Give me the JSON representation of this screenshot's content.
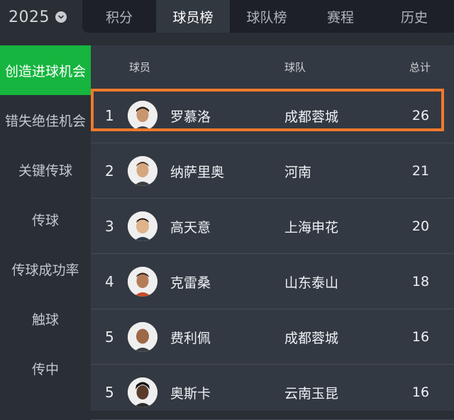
{
  "header": {
    "year": "2025",
    "year_icon": "chevron-down-icon",
    "tabs": [
      {
        "label": "积分"
      },
      {
        "label": "球员榜"
      },
      {
        "label": "球队榜"
      },
      {
        "label": "赛程"
      },
      {
        "label": "历史"
      }
    ],
    "active_tab": "球员榜"
  },
  "sidebar": {
    "items": [
      {
        "label": "创造进球机会"
      },
      {
        "label": "错失绝佳机会"
      },
      {
        "label": "关键传球"
      },
      {
        "label": "传球"
      },
      {
        "label": "传球成功率"
      },
      {
        "label": "触球"
      },
      {
        "label": "传中"
      }
    ],
    "active_item": "创造进球机会"
  },
  "table": {
    "columns": {
      "player": "球员",
      "team": "球队",
      "total": "总计"
    },
    "rows": [
      {
        "rank": "1",
        "player": "罗慕洛",
        "team": "成都蓉城",
        "total": "26"
      },
      {
        "rank": "2",
        "player": "纳萨里奥",
        "team": "河南",
        "total": "21"
      },
      {
        "rank": "3",
        "player": "高天意",
        "team": "上海申花",
        "total": "20"
      },
      {
        "rank": "4",
        "player": "克雷桑",
        "team": "山东泰山",
        "total": "18"
      },
      {
        "rank": "5",
        "player": "费利佩",
        "team": "成都蓉城",
        "total": "16"
      },
      {
        "rank": "5",
        "player": "奥斯卡",
        "team": "云南玉昆",
        "total": "16"
      }
    ]
  },
  "colors": {
    "accent_green": "#16b53f",
    "highlight_orange": "#f07a2c",
    "background": "#2a2f36",
    "table_background": "#333942"
  }
}
